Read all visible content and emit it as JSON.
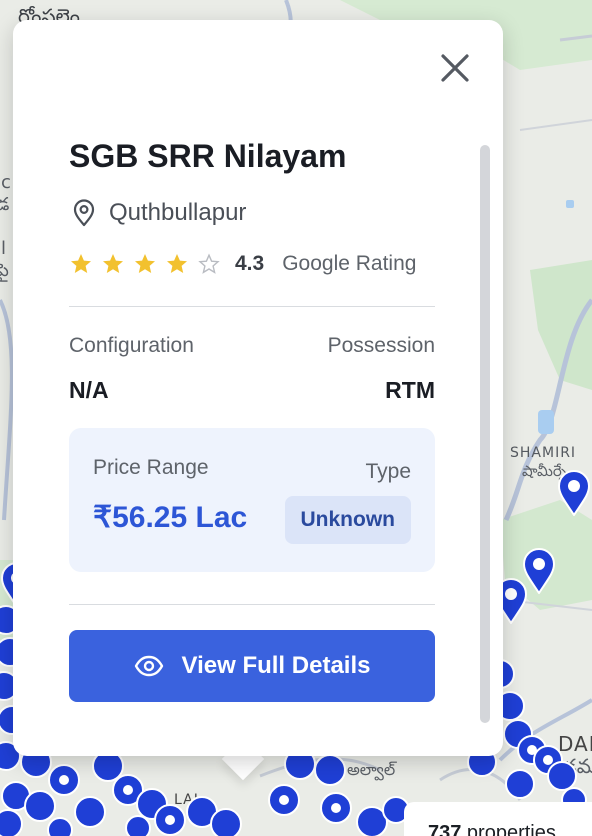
{
  "map": {
    "labels": {
      "top_left": "రోంపల్లెం",
      "left_1": "ic",
      "left_2": "డ",
      "left_3": "ll",
      "left_4": "పై",
      "shamirpet": "SHAMIRI",
      "shamirpet_te": "షామీర్పే",
      "alwal": "ALWAL",
      "alwal_te": "అల్వాల్",
      "dam": "DAM",
      "dam_te": "డమ",
      "lal": "LAL"
    },
    "property_count": "737",
    "property_count_suffix": " properties",
    "pin_color": "#1f3fd6"
  },
  "card": {
    "title": "SGB SRR Nilayam",
    "location": "Quthbullapur",
    "rating": 4.3,
    "rating_value": "4.3",
    "rating_label": "Google Rating",
    "configuration_label": "Configuration",
    "configuration_value": "N/A",
    "possession_label": "Possession",
    "possession_value": "RTM",
    "price_range_label": "Price Range",
    "price_range_value": "₹56.25 Lac",
    "type_label": "Type",
    "type_value": "Unknown",
    "cta_label": "View Full Details",
    "icons": {
      "close": "close-icon",
      "location": "location-pin-icon",
      "star_filled": "star-filled-icon",
      "star_empty": "star-empty-icon",
      "cta": "eye-icon"
    },
    "colors": {
      "accent": "#3a62de",
      "price": "#2d56d6",
      "star": "#f2c12e",
      "price_box_bg": "#eef3fd"
    }
  }
}
